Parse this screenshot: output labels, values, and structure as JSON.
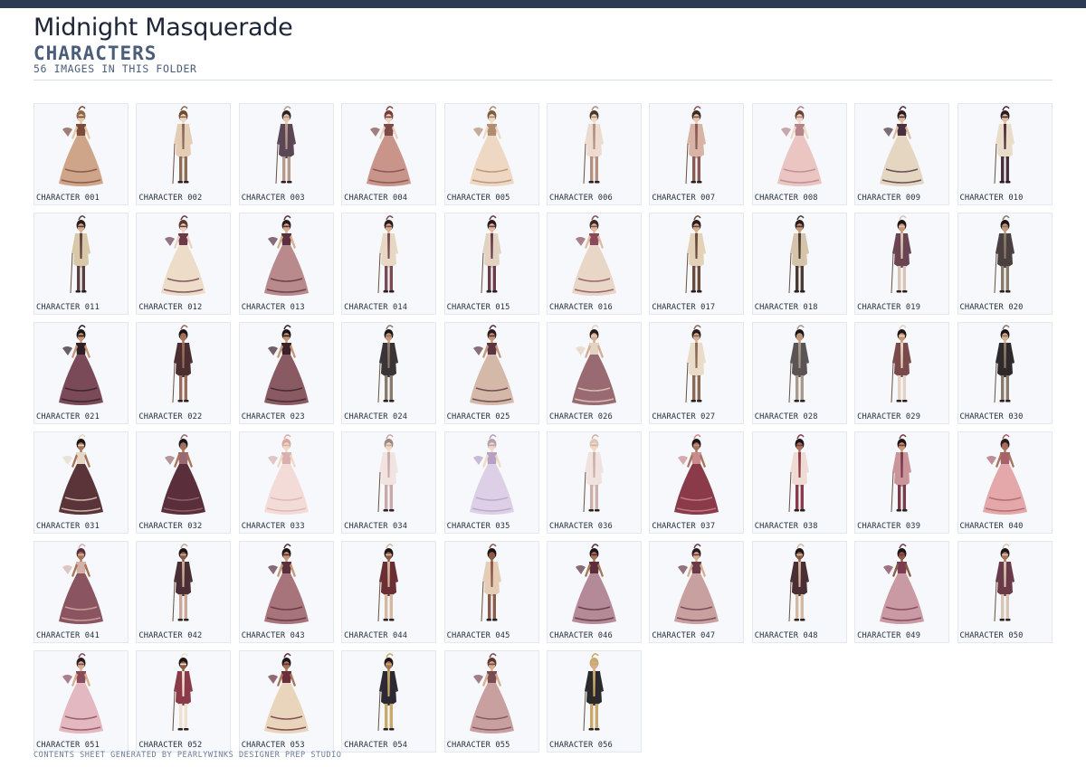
{
  "header": {
    "title": "Midnight Masquerade",
    "subtitle": "CHARACTERS",
    "count": "56 IMAGES IN THIS FOLDER"
  },
  "footer": {
    "text": "CONTENTS SHEET GENERATED BY PEARLYWINKS DESIGNER PREP STUDIO"
  },
  "palette": {
    "accent": "#2d3b52",
    "label_text": "#26303f",
    "card_bg": "#f6f8fb",
    "card_border": "#e3e7ee"
  },
  "items": [
    {
      "label": "CHARACTER 001",
      "kind": "gown",
      "outfit": "#cfa58a",
      "trim": "#7a4b3a",
      "skin": "#e8c6a8",
      "hair": "#8a6848"
    },
    {
      "label": "CHARACTER 002",
      "kind": "suit",
      "outfit": "#e5cdb5",
      "trim": "#8c6c55",
      "skin": "#f0d6c2",
      "hair": "#6b4a30"
    },
    {
      "label": "CHARACTER 003",
      "kind": "suit",
      "outfit": "#5a4654",
      "trim": "#b59a8a",
      "skin": "#e7c5aa",
      "hair": "#2d2222"
    },
    {
      "label": "CHARACTER 004",
      "kind": "gown",
      "outfit": "#c9958a",
      "trim": "#7d4a4a",
      "skin": "#efd2bd",
      "hair": "#7a3c3a"
    },
    {
      "label": "CHARACTER 005",
      "kind": "gown",
      "outfit": "#eed8c3",
      "trim": "#b08c70",
      "skin": "#f2d9c4",
      "hair": "#7c5b3f"
    },
    {
      "label": "CHARACTER 006",
      "kind": "suit",
      "outfit": "#eedbd0",
      "trim": "#b48f80",
      "skin": "#f2d9c4",
      "hair": "#4a3426"
    },
    {
      "label": "CHARACTER 007",
      "kind": "suit",
      "outfit": "#d8b3a6",
      "trim": "#8a5a55",
      "skin": "#e8c6a8",
      "hair": "#3a2a22"
    },
    {
      "label": "CHARACTER 008",
      "kind": "gown",
      "outfit": "#ebc5c2",
      "trim": "#b4858a",
      "skin": "#f2d9c4",
      "hair": "#6a4030"
    },
    {
      "label": "CHARACTER 009",
      "kind": "gown",
      "outfit": "#e4d6c0",
      "trim": "#4a2f3c",
      "skin": "#e2bb9c",
      "hair": "#2a1c1c"
    },
    {
      "label": "CHARACTER 010",
      "kind": "suit",
      "outfit": "#e9dcc9",
      "trim": "#4a2f3c",
      "skin": "#e2bb9c",
      "hair": "#2a1c1c"
    },
    {
      "label": "CHARACTER 011",
      "kind": "suit",
      "outfit": "#d9c8a8",
      "trim": "#5a3f40",
      "skin": "#d7ad8c",
      "hair": "#2a1c1c"
    },
    {
      "label": "CHARACTER 012",
      "kind": "gown",
      "outfit": "#ecdcc8",
      "trim": "#6a3a48",
      "skin": "#efd2bd",
      "hair": "#5a3a2a"
    },
    {
      "label": "CHARACTER 013",
      "kind": "gown",
      "outfit": "#b98a8c",
      "trim": "#5a2f3e",
      "skin": "#d7ad8c",
      "hair": "#2a1c1c"
    },
    {
      "label": "CHARACTER 014",
      "kind": "suit",
      "outfit": "#e7d8c4",
      "trim": "#7a4a52",
      "skin": "#d7ad8c",
      "hair": "#2a1c1c"
    },
    {
      "label": "CHARACTER 015",
      "kind": "suit",
      "outfit": "#e1d2c2",
      "trim": "#6a3a48",
      "skin": "#e2bb9c",
      "hair": "#2a1c1c"
    },
    {
      "label": "CHARACTER 016",
      "kind": "gown",
      "outfit": "#e8d6c6",
      "trim": "#8a4a5a",
      "skin": "#e2bb9c",
      "hair": "#3a2a22"
    },
    {
      "label": "CHARACTER 017",
      "kind": "suit",
      "outfit": "#e4d2b8",
      "trim": "#6a4a3a",
      "skin": "#d7ad8c",
      "hair": "#2a1c1c"
    },
    {
      "label": "CHARACTER 018",
      "kind": "suit",
      "outfit": "#d5c3aa",
      "trim": "#4a3a30",
      "skin": "#c79674",
      "hair": "#2a1c1c"
    },
    {
      "label": "CHARACTER 019",
      "kind": "suit",
      "outfit": "#6a4450",
      "trim": "#d8c4b4",
      "skin": "#c79674",
      "hair": "#1e1616"
    },
    {
      "label": "CHARACTER 020",
      "kind": "suit",
      "outfit": "#4a4040",
      "trim": "#8a7a6a",
      "skin": "#c79674",
      "hair": "#1e1616"
    },
    {
      "label": "CHARACTER 021",
      "kind": "gown",
      "outfit": "#7a4a58",
      "trim": "#2e1e26",
      "skin": "#c79674",
      "hair": "#1e1616"
    },
    {
      "label": "CHARACTER 022",
      "kind": "suit",
      "outfit": "#4a2e30",
      "trim": "#9a6a5a",
      "skin": "#a87458",
      "hair": "#1e1616"
    },
    {
      "label": "CHARACTER 023",
      "kind": "gown",
      "outfit": "#8a5a62",
      "trim": "#3a2028",
      "skin": "#c79674",
      "hair": "#1e1616"
    },
    {
      "label": "CHARACTER 024",
      "kind": "suit",
      "outfit": "#3a3436",
      "trim": "#8a7a6a",
      "skin": "#c79674",
      "hair": "#1e1616"
    },
    {
      "label": "CHARACTER 025",
      "kind": "gown",
      "outfit": "#d4b8a8",
      "trim": "#5a3440",
      "skin": "#c79674",
      "hair": "#2a1c1c"
    },
    {
      "label": "CHARACTER 026",
      "kind": "gown",
      "outfit": "#9a6a72",
      "trim": "#e4d2c2",
      "skin": "#d7ad8c",
      "hair": "#2a1c1c"
    },
    {
      "label": "CHARACTER 027",
      "kind": "suit",
      "outfit": "#eadcc8",
      "trim": "#8a6a55",
      "skin": "#d7ad8c",
      "hair": "#2a1c1c"
    },
    {
      "label": "CHARACTER 028",
      "kind": "suit",
      "outfit": "#5a5454",
      "trim": "#a89a8a",
      "skin": "#c79674",
      "hair": "#1e1616"
    },
    {
      "label": "CHARACTER 029",
      "kind": "suit",
      "outfit": "#7a4a4a",
      "trim": "#e4d2c2",
      "skin": "#c79674",
      "hair": "#1e1616"
    },
    {
      "label": "CHARACTER 030",
      "kind": "suit",
      "outfit": "#2e2a2c",
      "trim": "#8a7a6a",
      "skin": "#d7ad8c",
      "hair": "#1e1616"
    },
    {
      "label": "CHARACTER 031",
      "kind": "gown",
      "outfit": "#5a3438",
      "trim": "#e4d8c4",
      "skin": "#a87458",
      "hair": "#1e1616"
    },
    {
      "label": "CHARACTER 032",
      "kind": "gown",
      "outfit": "#5a2e3a",
      "trim": "#9a6a72",
      "skin": "#a87458",
      "hair": "#1e1616"
    },
    {
      "label": "CHARACTER 033",
      "kind": "gown",
      "outfit": "#f3dcd8",
      "trim": "#d9b0b0",
      "skin": "#f2d9c4",
      "hair": "#d8a8a0"
    },
    {
      "label": "CHARACTER 034",
      "kind": "suit",
      "outfit": "#f1e4e0",
      "trim": "#c9a8a8",
      "skin": "#f2d9c4",
      "hair": "#9a8a80"
    },
    {
      "label": "CHARACTER 035",
      "kind": "gown",
      "outfit": "#ddd0e6",
      "trim": "#b6a0c4",
      "skin": "#f2d9c4",
      "hair": "#b8a0a8"
    },
    {
      "label": "CHARACTER 036",
      "kind": "suit",
      "outfit": "#f0e2de",
      "trim": "#cdb0aa",
      "skin": "#f2d9c4",
      "hair": "#d8c8b8"
    },
    {
      "label": "CHARACTER 037",
      "kind": "gown",
      "outfit": "#8a3a48",
      "trim": "#c98a90",
      "skin": "#a87458",
      "hair": "#1e1616"
    },
    {
      "label": "CHARACTER 038",
      "kind": "suit",
      "outfit": "#efdad4",
      "trim": "#8a3a48",
      "skin": "#a87458",
      "hair": "#1e1616"
    },
    {
      "label": "CHARACTER 039",
      "kind": "suit",
      "outfit": "#c9949a",
      "trim": "#7a3a48",
      "skin": "#c79674",
      "hair": "#1e1616"
    },
    {
      "label": "CHARACTER 040",
      "kind": "gown",
      "outfit": "#e4a8aa",
      "trim": "#a8606a",
      "skin": "#a87458",
      "hair": "#2a1c1c"
    },
    {
      "label": "CHARACTER 041",
      "kind": "gown",
      "outfit": "#8a5460",
      "trim": "#d4b0a8",
      "skin": "#a87458",
      "hair": "#5a2e3a"
    },
    {
      "label": "CHARACTER 042",
      "kind": "suit",
      "outfit": "#4a2e34",
      "trim": "#c9a89a",
      "skin": "#8a5a42",
      "hair": "#1e1616"
    },
    {
      "label": "CHARACTER 043",
      "kind": "gown",
      "outfit": "#a8747c",
      "trim": "#5a2e3a",
      "skin": "#c79674",
      "hair": "#1e1616"
    },
    {
      "label": "CHARACTER 044",
      "kind": "suit",
      "outfit": "#6a2e34",
      "trim": "#d4b8a0",
      "skin": "#8a5a42",
      "hair": "#1e1616"
    },
    {
      "label": "CHARACTER 045",
      "kind": "suit",
      "outfit": "#e4cdb4",
      "trim": "#8a5a4a",
      "skin": "#8a5a42",
      "hair": "#1e1616"
    },
    {
      "label": "CHARACTER 046",
      "kind": "gown",
      "outfit": "#b48a98",
      "trim": "#5a2e3a",
      "skin": "#a87458",
      "hair": "#1e1616"
    },
    {
      "label": "CHARACTER 047",
      "kind": "gown",
      "outfit": "#c9a0a0",
      "trim": "#6a3a48",
      "skin": "#d7ad8c",
      "hair": "#2a1c1c"
    },
    {
      "label": "CHARACTER 048",
      "kind": "suit",
      "outfit": "#4a2e34",
      "trim": "#d4b8a0",
      "skin": "#8a5a42",
      "hair": "#1e1616"
    },
    {
      "label": "CHARACTER 049",
      "kind": "gown",
      "outfit": "#c99aa4",
      "trim": "#7a3a50",
      "skin": "#8a5a42",
      "hair": "#1e1616"
    },
    {
      "label": "CHARACTER 050",
      "kind": "suit",
      "outfit": "#6a3a48",
      "trim": "#d8c4b4",
      "skin": "#a87458",
      "hair": "#1e1616"
    },
    {
      "label": "CHARACTER 051",
      "kind": "gown",
      "outfit": "#e4b8c0",
      "trim": "#8a4a5a",
      "skin": "#d7ad8c",
      "hair": "#2a1c1c"
    },
    {
      "label": "CHARACTER 052",
      "kind": "suit",
      "outfit": "#8a3a48",
      "trim": "#efe0d0",
      "skin": "#8a5a42",
      "hair": "#1e1616"
    },
    {
      "label": "CHARACTER 053",
      "kind": "gown",
      "outfit": "#e9d4bc",
      "trim": "#6a2e3a",
      "skin": "#a87458",
      "hair": "#1e1616"
    },
    {
      "label": "CHARACTER 054",
      "kind": "suit",
      "outfit": "#2e2a34",
      "trim": "#c9a86a",
      "skin": "#a87458",
      "hair": "#1e1616"
    },
    {
      "label": "CHARACTER 055",
      "kind": "gown",
      "outfit": "#c9a0a0",
      "trim": "#7a4a52",
      "skin": "#d7ad8c",
      "hair": "#5a3a2a"
    },
    {
      "label": "CHARACTER 056",
      "kind": "suit",
      "outfit": "#2a2a2c",
      "trim": "#c9a86a",
      "skin": "#d7ad8c",
      "hair": "#c9a86a"
    }
  ]
}
